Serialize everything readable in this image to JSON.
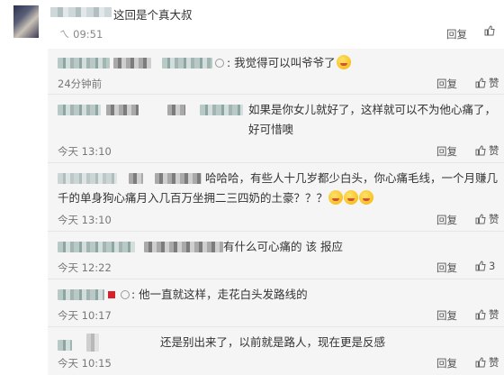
{
  "top_comment": {
    "text": "这回是个真大叔",
    "time": "09:51",
    "reply_label": "回复"
  },
  "replies": [
    {
      "text": ": 我觉得可以叫爷爷了",
      "time": "24分钟前",
      "reply_label": "回复",
      "like_label": "赞"
    },
    {
      "text": "如果是你女儿就好了，这样就可以不为他心痛了，好可惜噢",
      "time": "今天 13:10",
      "reply_label": "回复",
      "like_label": "赞"
    },
    {
      "text": "哈哈哈，有些人十几岁都少白头，你心痛毛线，一个月赚几千的单身狗心痛月入几百万坐拥二三四奶的土豪？？？",
      "time": "今天 13:10",
      "reply_label": "回复",
      "like_label": "赞"
    },
    {
      "text": "有什么可心痛的 该 报应",
      "time": "今天 12:22",
      "reply_label": "回复",
      "like_label": "3"
    },
    {
      "text": ": 他一直就这样，走花白头发路线的",
      "time": "今天 10:17",
      "reply_label": "回复",
      "like_label": "赞"
    },
    {
      "text": "还是别出来了，以前就是路人，现在更是反感",
      "time": "今天 10:15",
      "reply_label": "回复",
      "like_label": "赞"
    }
  ],
  "icons": {
    "like": "thumbs-up-icon",
    "emoji": "grin-emoji-icon",
    "medal": "medal-badge-icon"
  }
}
